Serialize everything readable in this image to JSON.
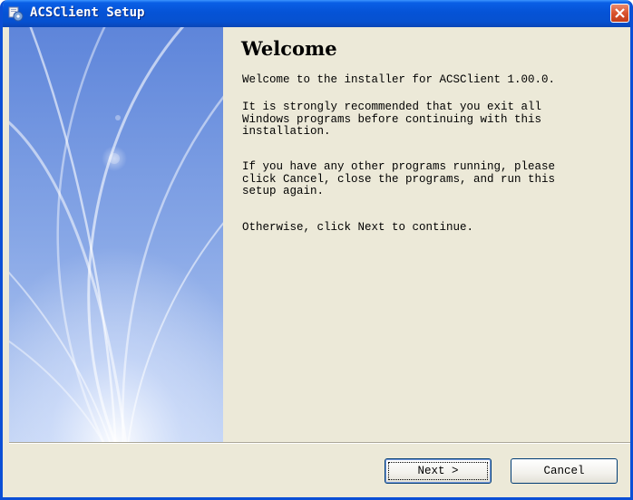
{
  "window": {
    "title": "ACSClient Setup",
    "icon": "installer-icon",
    "close_icon": "close-icon"
  },
  "main": {
    "heading": "Welcome",
    "paragraphs": [
      "Welcome to the installer for ACSClient 1.00.0.",
      "It is strongly recommended that you exit all\nWindows programs before continuing with this\ninstallation.",
      "If you have any other programs running, please\nclick Cancel, close the programs, and run this\nsetup again.",
      "Otherwise, click Next to continue."
    ]
  },
  "buttons": {
    "next_label": "Next >",
    "cancel_label": "Cancel"
  },
  "colors": {
    "titlebar": "#0553d6",
    "dialog_background": "#ece9d8",
    "sidebar_blue": "#5b82d9"
  }
}
